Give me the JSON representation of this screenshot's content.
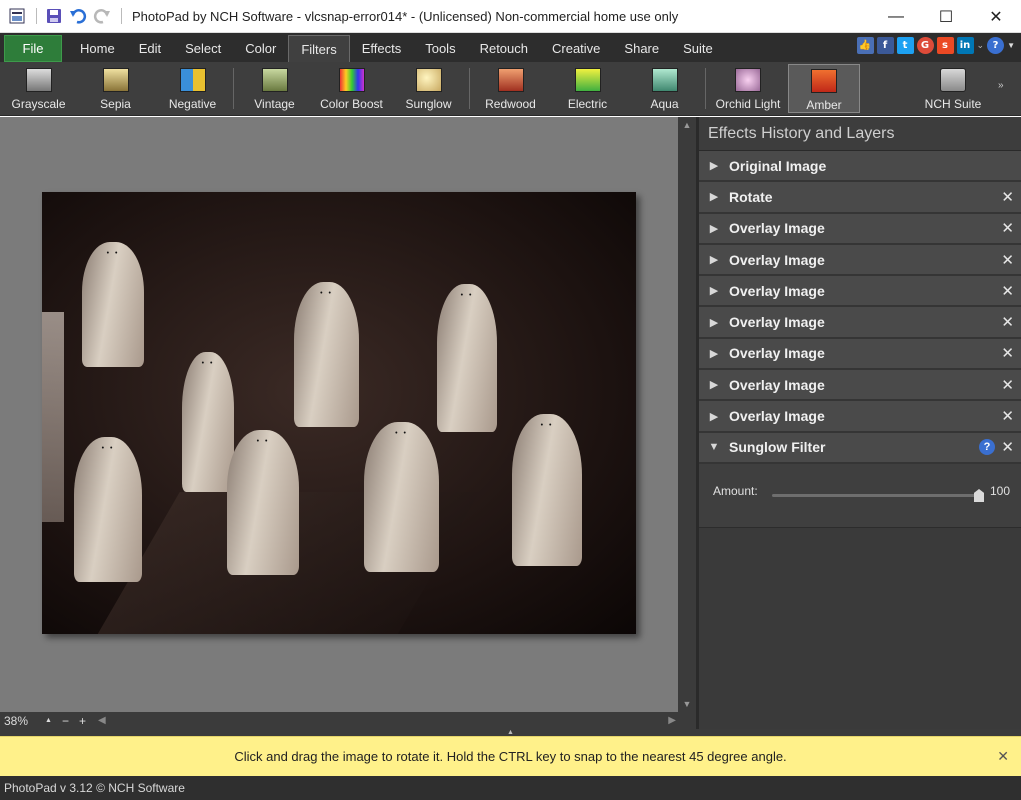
{
  "window": {
    "title": "PhotoPad by NCH Software - vlcsnap-error014* - (Unlicensed) Non-commercial home use only",
    "quick_access": [
      "app-menu-icon",
      "save-icon",
      "undo-icon",
      "redo-icon"
    ],
    "controls": {
      "minimize": "—",
      "maximize": "☐",
      "close": "✕"
    }
  },
  "menu": {
    "file": "File",
    "items": [
      "Home",
      "Edit",
      "Select",
      "Color",
      "Filters",
      "Effects",
      "Tools",
      "Retouch",
      "Creative",
      "Share",
      "Suite"
    ],
    "active": "Filters",
    "social": [
      "thumbs-up-icon",
      "facebook-icon",
      "twitter-icon",
      "google-plus-icon",
      "stumbleupon-icon",
      "linkedin-icon",
      "help-icon"
    ]
  },
  "toolbar": {
    "tools": [
      {
        "label": "Grayscale",
        "icon": "grayscale-icon"
      },
      {
        "label": "Sepia",
        "icon": "sepia-icon"
      },
      {
        "label": "Negative",
        "icon": "negative-icon"
      },
      {
        "label": "Vintage",
        "icon": "vintage-icon"
      },
      {
        "label": "Color Boost",
        "icon": "color-boost-icon"
      },
      {
        "label": "Sunglow",
        "icon": "sunglow-icon"
      },
      {
        "label": "Redwood",
        "icon": "redwood-icon"
      },
      {
        "label": "Electric",
        "icon": "electric-icon"
      },
      {
        "label": "Aqua",
        "icon": "aqua-icon"
      },
      {
        "label": "Orchid Light",
        "icon": "orchid-light-icon"
      },
      {
        "label": "Amber",
        "icon": "amber-icon"
      },
      {
        "label": "NCH Suite",
        "icon": "nch-suite-icon"
      }
    ],
    "active": "Amber"
  },
  "zoom": {
    "value": "38%",
    "up": "▲",
    "minus": "−",
    "plus": "+"
  },
  "panel": {
    "title": "Effects History and Layers",
    "layers": [
      {
        "label": "Original Image",
        "removable": false
      },
      {
        "label": "Rotate",
        "removable": true
      },
      {
        "label": "Overlay Image",
        "removable": true
      },
      {
        "label": "Overlay Image",
        "removable": true
      },
      {
        "label": "Overlay Image",
        "removable": true
      },
      {
        "label": "Overlay Image",
        "removable": true
      },
      {
        "label": "Overlay Image",
        "removable": true
      },
      {
        "label": "Overlay Image",
        "removable": true
      },
      {
        "label": "Overlay Image",
        "removable": true
      }
    ],
    "filter": {
      "label": "Sunglow Filter",
      "amount_label": "Amount:",
      "amount_value": "100",
      "amount_fraction": 1.0
    }
  },
  "hint": {
    "text": "Click and drag the image to rotate it. Hold the CTRL key to snap to the nearest 45 degree angle.",
    "close": "✕"
  },
  "status": {
    "text": "PhotoPad v 3.12 © NCH Software"
  },
  "colors": {
    "file_green": "#2e7d3a",
    "hint_yellow": "#fff18a",
    "help_blue": "#3a6fd0"
  }
}
